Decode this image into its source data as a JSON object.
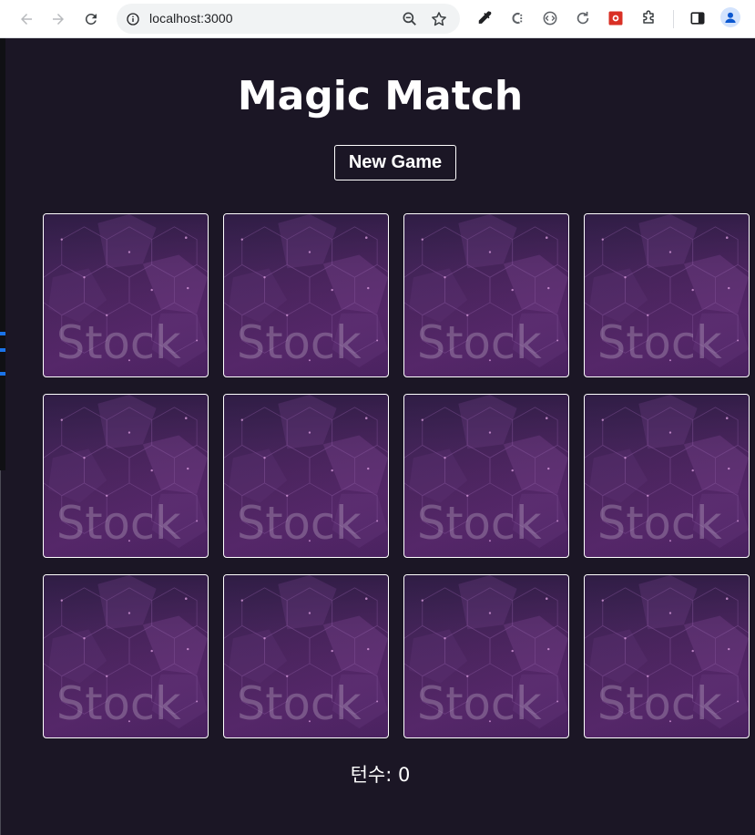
{
  "browser": {
    "url": "localhost:3000"
  },
  "app": {
    "title": "Magic Match",
    "new_game_label": "New Game",
    "turns_label": "턴수:",
    "turns_value": "0",
    "card_back_watermark": "Stock",
    "cards": [
      {
        "state": "face-down"
      },
      {
        "state": "face-down"
      },
      {
        "state": "face-down"
      },
      {
        "state": "face-down"
      },
      {
        "state": "face-down"
      },
      {
        "state": "face-down"
      },
      {
        "state": "face-down"
      },
      {
        "state": "face-down"
      },
      {
        "state": "face-down"
      },
      {
        "state": "face-down"
      },
      {
        "state": "face-down"
      },
      {
        "state": "face-down"
      }
    ]
  },
  "colors": {
    "page_background": "#1b1625",
    "card_border": "#ffffff",
    "card_back": "#4d2560",
    "text": "#ffffff"
  }
}
